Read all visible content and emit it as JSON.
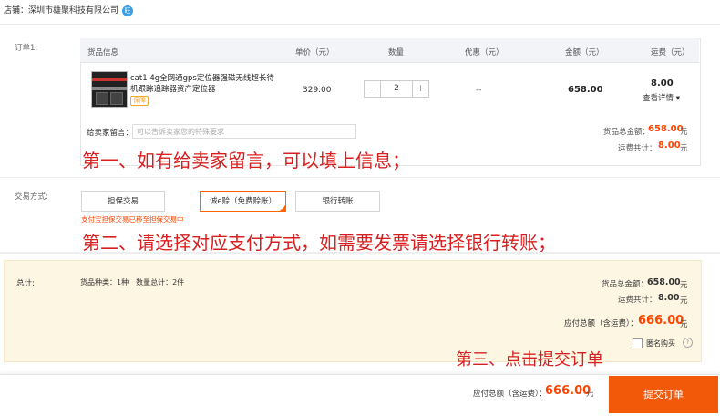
{
  "shop": {
    "label": "店铺：",
    "name": "深圳市雄聚科技有限公司",
    "badge": "旺"
  },
  "order": {
    "label": "订单1:",
    "headers": {
      "goods": "货品信息",
      "price": "单价（元）",
      "qty": "数量",
      "discount": "优惠（元）",
      "amount": "金额（元）",
      "shipping": "运费（元）"
    },
    "item": {
      "name": "cat1 4g全网通gps定位器强磁无线超长待机跟踪追踪器资产定位器",
      "tag": "保障",
      "price": "329.00",
      "qty": "2",
      "discount": "--",
      "amount": "658.00",
      "shipping": "8.00",
      "detail_link": "查看详情 ▾"
    },
    "message": {
      "label": "给卖家留言：",
      "placeholder": "可以告诉卖家您的特殊要求"
    },
    "subtotal": {
      "goods_label": "货品总金额：",
      "goods_value": "658.00",
      "ship_label": "运费共计：",
      "ship_value": "8.00",
      "unit": "元"
    }
  },
  "annotations": {
    "step1": "第一、如有给卖家留言，可以填上信息；",
    "step2": "第二、请选择对应支付方式，如需要发票请选择银行转账；",
    "step3": "第三、点击提交订单"
  },
  "payment": {
    "label": "交易方式:",
    "options": [
      "担保交易",
      "诚e赊（免费赊账）",
      "银行转账"
    ],
    "selected_index": 1,
    "note": "支付宝担保交易已移至担保交易中"
  },
  "summary": {
    "label": "总计:",
    "kinds": "货品种类：1种　数量总计：2件",
    "goods_label": "货品总金额：",
    "goods_value": "658.00",
    "ship_label": "运费共计：",
    "ship_value": "8.00",
    "pay_label": "应付总额（含运费）：",
    "pay_value": "666.00",
    "unit": "元",
    "anonymous_label": "匿名购买",
    "help_mark": "?"
  },
  "bottom": {
    "pay_label": "应付总额（含运费）：",
    "pay_value": "666.00",
    "unit": "元",
    "submit": "提交订单"
  },
  "colors": {
    "accent": "#f25a0a",
    "price": "#ff4400",
    "annotation": "#d91f1f",
    "summary_bg": "#fdf6e3"
  }
}
